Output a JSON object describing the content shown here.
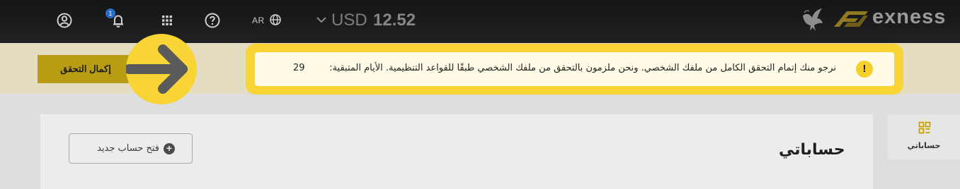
{
  "header": {
    "notification_count": "1",
    "language": "AR",
    "currency": "USD",
    "balance": "12.52",
    "brand": "exness",
    "icons": [
      "user-circle-icon",
      "bell-icon",
      "apps-grid-icon",
      "help-icon",
      "globe-icon",
      "chevron-down-icon"
    ]
  },
  "verification": {
    "button_label": "إكمال التحقق",
    "notice_text": "نرجو منك إتمام التحقق الكامل من ملفك الشخصي. ونحن ملزمون بالتحقق من ملفك الشخصي طبقًا للقواعد التنظيمية. الأيام المتبقية:",
    "days_remaining": "29",
    "highlight_color": "#f8d535"
  },
  "main": {
    "title": "حساباتي",
    "new_account_label": "فتح حساب جديد"
  },
  "sidebar": {
    "tab_label": "حساباتي",
    "accent_color": "#c9a300"
  }
}
